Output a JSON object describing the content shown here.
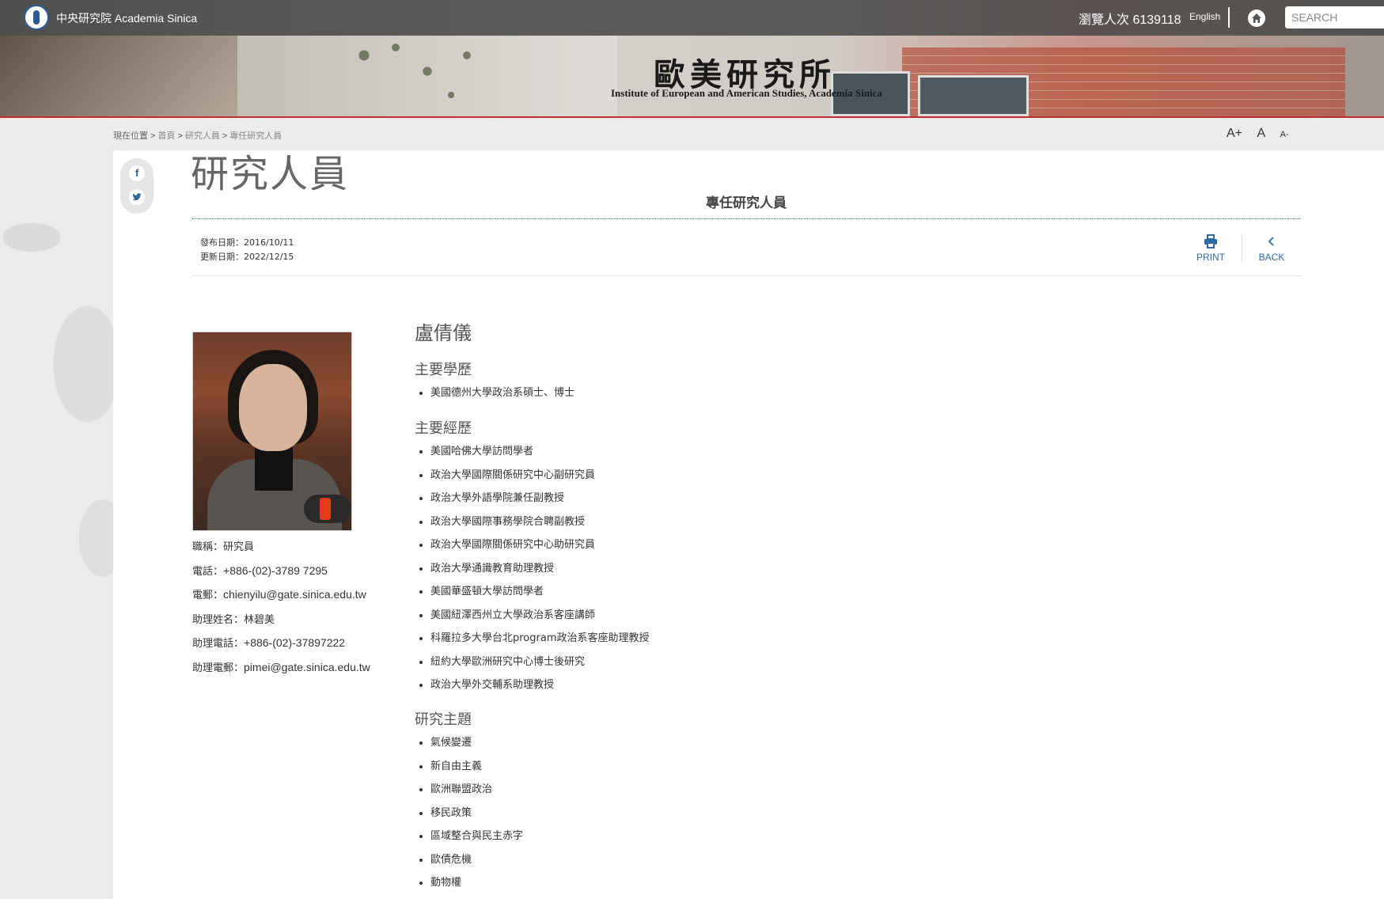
{
  "topbar": {
    "site_name": "中央研究院 Academia Sinica",
    "visit_count": "瀏覽人次 6139118",
    "english_label": "English",
    "search_placeholder": "SEARCH"
  },
  "banner": {
    "title": "歐美研究所",
    "subtitle": "Institute of European and American Studies, Academia Sinica"
  },
  "breadcrumb": {
    "items": [
      "現在位置",
      "首頁",
      "研究人員",
      "專任研究人員"
    ]
  },
  "font_controls": {
    "large": "A+",
    "normal": "A",
    "small": "A-"
  },
  "share": {
    "facebook": "f",
    "twitter": "t"
  },
  "page": {
    "title": "研究人員",
    "subtitle": "專任研究人員",
    "published": "發布日期：2016/10/11",
    "updated": "更新日期：2022/12/15",
    "print_label": "PRINT",
    "back_label": "BACK"
  },
  "profile": {
    "name": "盧倩儀",
    "contacts": [
      {
        "label": "職稱：",
        "value": "研究員"
      },
      {
        "label": "電話：",
        "value": "+886-(02)-3789 7295"
      },
      {
        "label": "電郵：",
        "value": "chienyilu@gate.sinica.edu.tw"
      },
      {
        "label": "助理姓名：",
        "value": "林碧美"
      },
      {
        "label": "助理電話：",
        "value": "+886-(02)-37897222"
      },
      {
        "label": "助理電郵：",
        "value": "pimei@gate.sinica.edu.tw"
      }
    ],
    "education_heading": "主要學歷",
    "education": [
      "美國德州大學政治系碩士、博士"
    ],
    "experience_heading": "主要經歷",
    "experience": [
      "美國哈佛大學訪問學者",
      "政治大學國際關係研究中心副研究員",
      "政治大學外語學院兼任副教授",
      "政治大學國際事務學院合聘副教授",
      "政治大學國際關係研究中心助研究員",
      "政治大學通識教育助理教授",
      "美國華盛頓大學訪問學者",
      "美國紐澤西州立大學政治系客座講師",
      "科羅拉多大學台北program政治系客座助理教授",
      "紐約大學歐洲研究中心博士後研究",
      "政治大學外交輔系助理教授"
    ],
    "research_heading": "研究主題",
    "research": [
      "氣候變遷",
      "新自由主義",
      "歐洲聯盟政治",
      "移民政策",
      "區域整合與民主赤字",
      "歐債危機",
      "動物權"
    ]
  }
}
